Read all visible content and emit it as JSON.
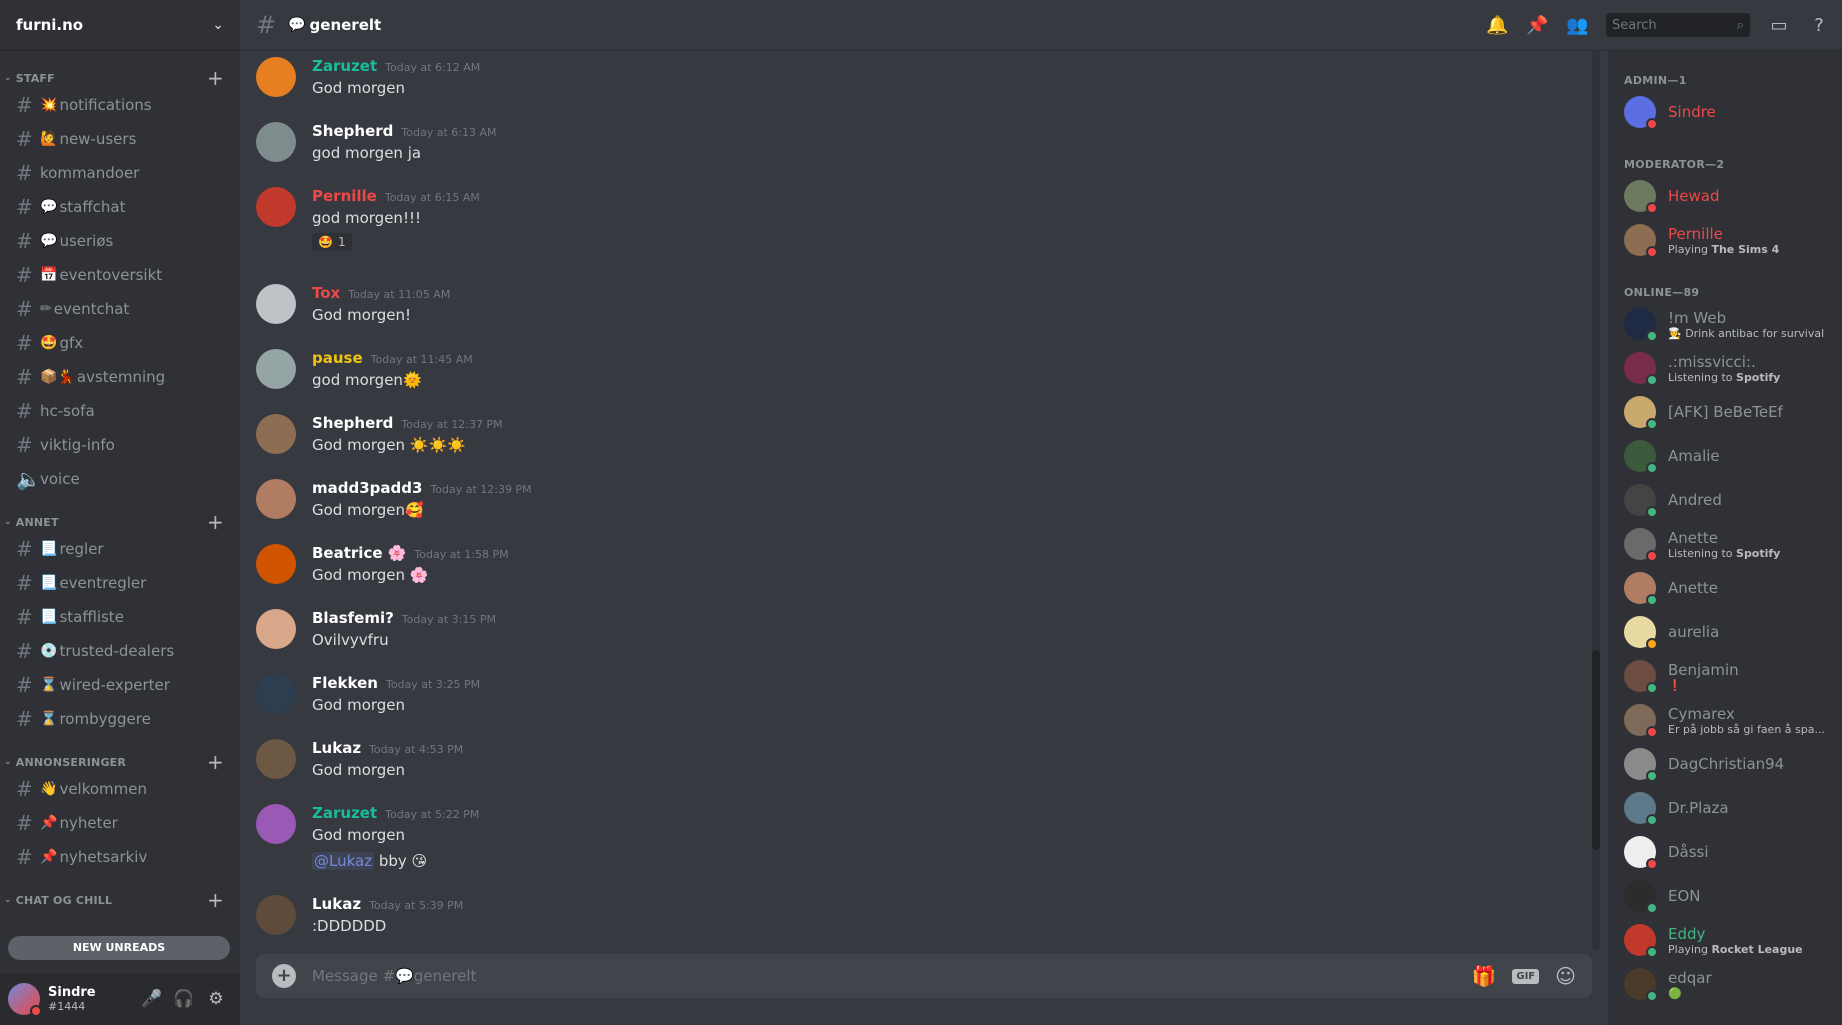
{
  "server": {
    "name": "furni.no"
  },
  "categories": [
    {
      "name": "STAFF",
      "channels": [
        {
          "icon": "💥",
          "name": "notifications"
        },
        {
          "icon": "🙋",
          "name": "new-users"
        },
        {
          "icon": "",
          "name": "kommandoer"
        },
        {
          "icon": "💬",
          "name": "staffchat"
        },
        {
          "icon": "💬",
          "name": "useriøs"
        },
        {
          "icon": "📅",
          "name": "eventoversikt"
        },
        {
          "icon": "✏",
          "name": "eventchat"
        },
        {
          "icon": "🤩",
          "name": "gfx"
        },
        {
          "icon": "📦💃",
          "name": "avstemning"
        },
        {
          "icon": "",
          "name": "hc-sofa"
        },
        {
          "icon": "",
          "name": "viktig-info"
        },
        {
          "icon": "",
          "name": "voice"
        }
      ]
    },
    {
      "name": "ANNET",
      "channels": [
        {
          "icon": "📃",
          "name": "regler"
        },
        {
          "icon": "📃",
          "name": "eventregler"
        },
        {
          "icon": "📃",
          "name": "staffliste"
        },
        {
          "icon": "💿",
          "name": "trusted-dealers"
        },
        {
          "icon": "⌛",
          "name": "wired-experter"
        },
        {
          "icon": "⌛",
          "name": "rombyggere"
        }
      ]
    },
    {
      "name": "ANNONSERINGER",
      "channels": [
        {
          "icon": "👋",
          "name": "velkommen"
        },
        {
          "icon": "📌",
          "name": "nyheter"
        },
        {
          "icon": "📌",
          "name": "nyhetsarkiv"
        }
      ]
    },
    {
      "name": "CHAT OG CHILL",
      "channels": []
    }
  ],
  "new_unreads": "NEW UNREADS",
  "user": {
    "name": "Sindre",
    "tag": "#1444"
  },
  "channel": {
    "icon": "💬",
    "name": "generelt"
  },
  "search": {
    "placeholder": "Search"
  },
  "messages": [
    {
      "author": "Zaruzet",
      "color": "#1abc9c",
      "time": "Today at 6:12 AM",
      "lines": [
        "God morgen"
      ]
    },
    {
      "author": "Shepherd",
      "color": "#ffffff",
      "time": "Today at 6:13 AM",
      "lines": [
        "god morgen ja"
      ]
    },
    {
      "author": "Pernille",
      "color": "#f04747",
      "time": "Today at 6:15 AM",
      "lines": [
        "god morgen!!!"
      ],
      "reaction": {
        "emoji": "🤩",
        "count": "1"
      }
    },
    {
      "author": "Tox",
      "color": "#f04747",
      "time": "Today at 11:05 AM",
      "lines": [
        "God morgen!"
      ]
    },
    {
      "author": "pause",
      "color": "#f1c40f",
      "time": "Today at 11:45 AM",
      "lines": [
        "god morgen🌞"
      ]
    },
    {
      "author": "Shepherd",
      "color": "#ffffff",
      "time": "Today at 12:37 PM",
      "lines": [
        "God morgen ☀️☀️☀️"
      ]
    },
    {
      "author": "madd3padd3",
      "color": "#ffffff",
      "time": "Today at 12:39 PM",
      "lines": [
        "God morgen🥰"
      ]
    },
    {
      "author": "Beatrice 🌸",
      "color": "#ffffff",
      "time": "Today at 1:58 PM",
      "lines": [
        "God morgen 🌸"
      ]
    },
    {
      "author": "Blasfemi?",
      "color": "#ffffff",
      "time": "Today at 3:15 PM",
      "lines": [
        "Ovilvyvfru"
      ]
    },
    {
      "author": "Flekken",
      "color": "#ffffff",
      "time": "Today at 3:25 PM",
      "lines": [
        "God morgen"
      ]
    },
    {
      "author": "Lukaz",
      "color": "#ffffff",
      "time": "Today at 4:53 PM",
      "lines": [
        "God morgen"
      ]
    },
    {
      "author": "Zaruzet",
      "color": "#1abc9c",
      "time": "Today at 5:22 PM",
      "lines": [
        "God morgen"
      ],
      "mention": "@Lukaz",
      "mention_tail": " bby 😘"
    },
    {
      "author": "Lukaz",
      "color": "#ffffff",
      "time": "Today at 5:39 PM",
      "lines": [
        ":DDDDDD"
      ]
    }
  ],
  "composer": {
    "placeholder": "Message #💬generelt",
    "gif_label": "GIF"
  },
  "members": {
    "roles": [
      {
        "label": "ADMIN—1",
        "members": [
          {
            "name": "Sindre",
            "color": "#f04747",
            "status": "#f04747",
            "activity": ""
          }
        ]
      },
      {
        "label": "MODERATOR—2",
        "members": [
          {
            "name": "Hewad",
            "color": "#f04747",
            "status": "#f04747",
            "activity": ""
          },
          {
            "name": "Pernille",
            "color": "#f04747",
            "status": "#f04747",
            "activity": "Playing ",
            "activity_bold": "The Sims 4"
          }
        ]
      },
      {
        "label": "ONLINE—89",
        "members": [
          {
            "name": "!m Web",
            "color": "#8e9297",
            "status": "#43b581",
            "activity": "🧑‍🍳 Drink antibac for survival"
          },
          {
            "name": ".:missvicci:.",
            "color": "#8e9297",
            "status": "#43b581",
            "activity": "Listening to ",
            "activity_bold": "Spotify"
          },
          {
            "name": "[AFK] BeBeTeEf",
            "color": "#8e9297",
            "status": "#43b581",
            "activity": ""
          },
          {
            "name": "Amalie",
            "color": "#8e9297",
            "status": "#43b581",
            "activity": ""
          },
          {
            "name": "Andred",
            "color": "#8e9297",
            "status": "#43b581",
            "activity": ""
          },
          {
            "name": "Anette",
            "color": "#8e9297",
            "status": "#f04747",
            "activity": "Listening to ",
            "activity_bold": "Spotify"
          },
          {
            "name": "Anette",
            "color": "#8e9297",
            "status": "#43b581",
            "activity": ""
          },
          {
            "name": "aurelia",
            "color": "#8e9297",
            "status": "#faa61a",
            "activity": ""
          },
          {
            "name": "Benjamin",
            "color": "#8e9297",
            "status": "#43b581",
            "activity": "❗"
          },
          {
            "name": "Cymarex",
            "color": "#8e9297",
            "status": "#f04747",
            "activity": "Er på jobb så gi faen å spa..."
          },
          {
            "name": "DagChristian94",
            "color": "#8e9297",
            "status": "#43b581",
            "activity": ""
          },
          {
            "name": "Dr.Plaza",
            "color": "#8e9297",
            "status": "#43b581",
            "activity": ""
          },
          {
            "name": "Dåssi",
            "color": "#8e9297",
            "status": "#f04747",
            "activity": ""
          },
          {
            "name": "EON",
            "color": "#8e9297",
            "status": "#43b581",
            "activity": ""
          },
          {
            "name": "Eddy",
            "color": "#43b581",
            "status": "#43b581",
            "activity": "Playing ",
            "activity_bold": "Rocket League"
          },
          {
            "name": "edqar",
            "color": "#8e9297",
            "status": "#43b581",
            "activity": "🟢"
          }
        ]
      }
    ]
  },
  "colors": {
    "accent": "#7289da",
    "online": "#43b581",
    "dnd": "#f04747",
    "idle": "#faa61a"
  }
}
